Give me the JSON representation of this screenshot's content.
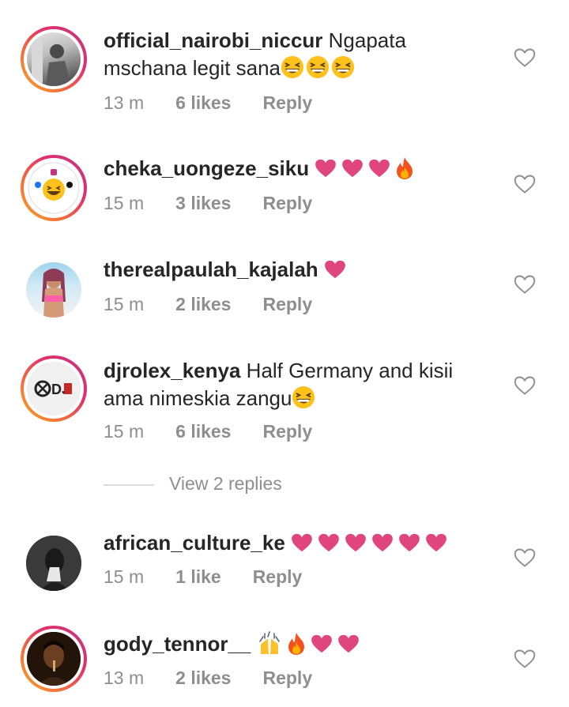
{
  "comments": [
    {
      "username": "official_nairobi_niccur",
      "text": " Ngapata mschana legit sana",
      "emoji": "grinning-squinting x3",
      "time": "13 m",
      "likes": "6 likes",
      "reply": "Reply"
    },
    {
      "username": "cheka_uongeze_siku",
      "text": "",
      "emoji": "hearts x3, fire",
      "time": "15 m",
      "likes": "3 likes",
      "reply": "Reply"
    },
    {
      "username": "therealpaulah_kajalah",
      "text": "",
      "emoji": "heart",
      "time": "15 m",
      "likes": "2 likes",
      "reply": "Reply"
    },
    {
      "username": "djrolex_kenya",
      "text": " Half Germany and kisii ama nimeskia zangu",
      "emoji": "grinning-squinting",
      "time": "15 m",
      "likes": "6 likes",
      "reply": "Reply",
      "view_replies": "View 2 replies"
    },
    {
      "username": "african_culture_ke",
      "text": "",
      "emoji": "hearts x6",
      "time": "15 m",
      "likes": "1 like",
      "reply": "Reply"
    },
    {
      "username": "gody_tennor__",
      "text": "",
      "emoji": "raising-hands, fire, hearts x2",
      "time": "13 m",
      "likes": "2 likes",
      "reply": "Reply"
    }
  ],
  "colors": {
    "heart": "#e0457b",
    "meta": "#8e8e8e",
    "text": "#262626",
    "ring_start": "#f9a826",
    "ring_end": "#c13584"
  }
}
